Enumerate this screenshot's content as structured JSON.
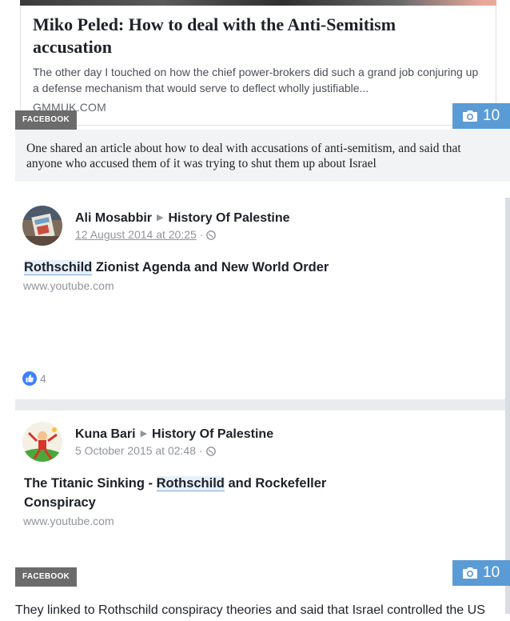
{
  "top_card": {
    "title": "Miko Peled: How to deal with the Anti-Semitism accusation",
    "description": "The other day I touched on how the chief power-brokers did such a grand job conjuring up a defense mechanism that would serve to deflect wholly justifiable...",
    "domain": "GMMUK.COM",
    "source_badge": "FACEBOOK",
    "photo_count": "10"
  },
  "caption_1": "One shared an article about how to deal with accusations of anti-semitism, and said that anyone who accused them of it was trying to shut them up about Israel",
  "posts": [
    {
      "author": "Ali Mosabbir",
      "group": "History Of Palestine",
      "date": "12 August 2014 at 20:25",
      "text_highlight": "Rothschild",
      "text_rest": " Zionist Agenda and New World Order",
      "url": "www.youtube.com",
      "likes": "4"
    },
    {
      "author": "Kuna Bari",
      "group": "History Of Palestine",
      "date": "5 October 2015 at 02:48",
      "text_before": "The Titanic Sinking - ",
      "text_highlight": "Rothschild",
      "text_after": " and Rockefeller",
      "text_line2": "Conspiracy",
      "url": "www.youtube.com"
    }
  ],
  "bottom": {
    "source_badge": "FACEBOOK",
    "photo_count": "10"
  },
  "caption_2": "They linked to Rothschild conspiracy theories and said that Israel controlled the US",
  "colors": {
    "accent": "#5b9bd5",
    "badge": "#6b6b6b",
    "caption_bg": "#f1f3f5",
    "like_blue": "#4080ff"
  },
  "icons": [
    "camera-icon",
    "globe-icon",
    "like-icon",
    "caret-right-icon"
  ]
}
